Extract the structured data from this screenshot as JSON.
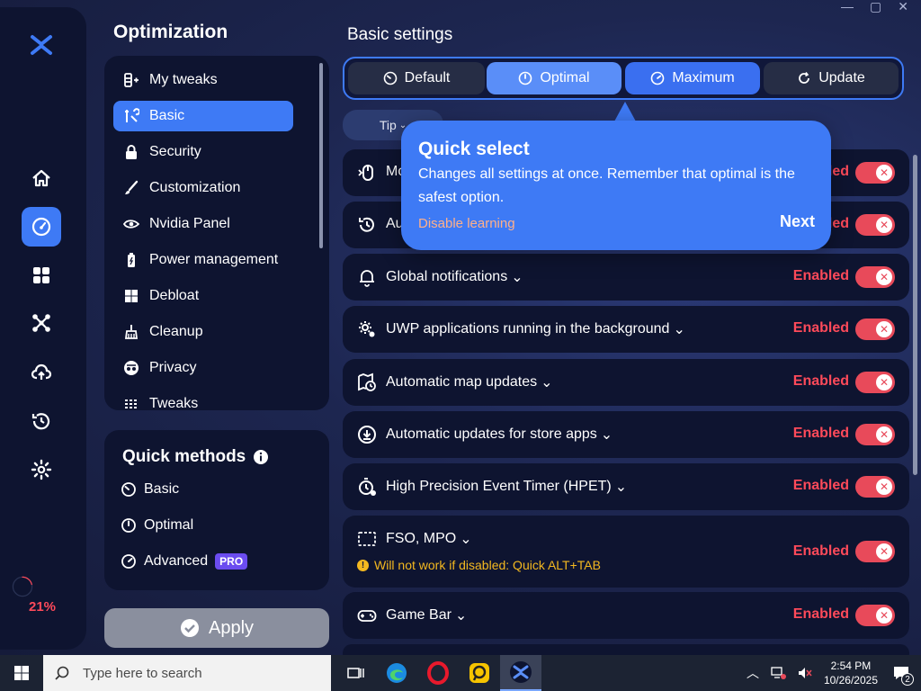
{
  "colors": {
    "accent": "#3e7af5",
    "enabled_red": "#ff4a5a",
    "warning_yellow": "#f3b820",
    "panel": "#0e1430",
    "pro_badge": "#6b4cf0"
  },
  "rail": {
    "progress_label": "21%",
    "progress_value": 0.21,
    "items": [
      {
        "name": "home-icon",
        "active": false
      },
      {
        "name": "speedometer-icon",
        "active": true
      },
      {
        "name": "apps-grid-icon",
        "active": false
      },
      {
        "name": "network-icon",
        "active": false
      },
      {
        "name": "cloud-upload-icon",
        "active": false
      },
      {
        "name": "history-icon",
        "active": false
      },
      {
        "name": "gear-icon",
        "active": false
      }
    ]
  },
  "optimization": {
    "title": "Optimization",
    "menu": [
      {
        "label": "My tweaks",
        "icon": "list-plus-icon",
        "active": false
      },
      {
        "label": "Basic",
        "icon": "tools-icon",
        "active": true
      },
      {
        "label": "Security",
        "icon": "lock-icon",
        "active": false
      },
      {
        "label": "Customization",
        "icon": "brush-icon",
        "active": false
      },
      {
        "label": "Nvidia Panel",
        "icon": "nvidia-icon",
        "active": false
      },
      {
        "label": "Power management",
        "icon": "battery-icon",
        "active": false
      },
      {
        "label": "Debloat",
        "icon": "windows-icon",
        "active": false
      },
      {
        "label": "Cleanup",
        "icon": "broom-icon",
        "active": false
      },
      {
        "label": "Privacy",
        "icon": "spy-icon",
        "active": false
      },
      {
        "label": "Tweaks",
        "icon": "tweaks-icon",
        "active": false
      }
    ]
  },
  "quick_methods": {
    "title": "Quick methods",
    "items": [
      {
        "label": "Basic",
        "icon": "gauge-low-icon"
      },
      {
        "label": "Optimal",
        "icon": "gauge-mid-icon"
      },
      {
        "label": "Advanced",
        "icon": "gauge-high-icon",
        "badge": "PRO"
      }
    ]
  },
  "apply_label": "Apply",
  "basic_settings": {
    "title": "Basic settings",
    "presets": [
      {
        "label": "Default",
        "icon": "gauge-low-icon"
      },
      {
        "label": "Optimal",
        "icon": "gauge-mid-icon"
      },
      {
        "label": "Maximum",
        "icon": "gauge-high-icon"
      },
      {
        "label": "Update",
        "icon": "refresh-icon"
      }
    ],
    "tip_label": "Tip"
  },
  "tooltip": {
    "title": "Quick select",
    "body": "Changes all settings at once. Remember that optimal is the safest option.",
    "disable": "Disable learning",
    "next": "Next"
  },
  "settings": [
    {
      "label": "Mo",
      "icon": "mouse-icon",
      "status": "Enabled"
    },
    {
      "label": "Au",
      "icon": "clock-refresh-icon",
      "status": "Enabled"
    },
    {
      "label": "Global notifications",
      "icon": "bell-icon",
      "status": "Enabled"
    },
    {
      "label": "UWP applications running in the background",
      "icon": "gears-icon",
      "status": "Enabled"
    },
    {
      "label": "Automatic map updates",
      "icon": "map-clock-icon",
      "status": "Enabled"
    },
    {
      "label": "Automatic updates for store apps",
      "icon": "download-circle-icon",
      "status": "Enabled"
    },
    {
      "label": "High Precision Event Timer (HPET)",
      "icon": "timer-icon",
      "status": "Enabled"
    },
    {
      "label": "FSO, MPO",
      "icon": "fullscreen-icon",
      "status": "Enabled",
      "warning": "Will not work if disabled: Quick ALT+TAB"
    },
    {
      "label": "Game Bar",
      "icon": "gamepad-icon",
      "status": "Enabled"
    }
  ],
  "taskbar": {
    "search_placeholder": "Type here to search",
    "time": "2:54 PM",
    "date": "10/26/2025",
    "notification_count": "2"
  }
}
